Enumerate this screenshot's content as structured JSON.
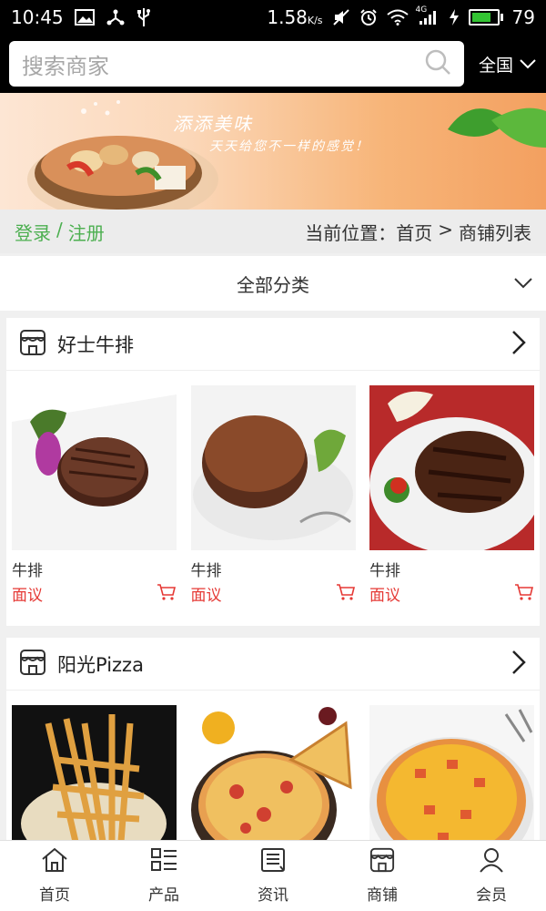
{
  "status": {
    "time": "10:45",
    "speed": "1.58",
    "speed_unit": "K/s",
    "network": "4G",
    "battery": "79",
    "battery_level": 0.79
  },
  "search": {
    "placeholder": "搜索商家"
  },
  "region": {
    "label": "全国"
  },
  "banner": {
    "line1": "添添美味",
    "line2": "天天给您不一样的感觉！"
  },
  "auth": {
    "login": "登录",
    "separator": "/",
    "register": "注册"
  },
  "breadcrumb": {
    "prefix": "当前位置：",
    "home": "首页",
    "separator": ">",
    "current": "商铺列表"
  },
  "category": {
    "label": "全部分类"
  },
  "shops": [
    {
      "name": "好士牛排",
      "products": [
        {
          "name": "牛排",
          "price": "面议"
        },
        {
          "name": "牛排",
          "price": "面议"
        },
        {
          "name": "牛排",
          "price": "面议"
        }
      ]
    },
    {
      "name": "阳光Pizza",
      "products": [
        {
          "name": "",
          "price": ""
        },
        {
          "name": "",
          "price": ""
        },
        {
          "name": "",
          "price": ""
        }
      ]
    }
  ],
  "nav": [
    {
      "label": "首页",
      "icon": "home-icon"
    },
    {
      "label": "产品",
      "icon": "grid-list-icon"
    },
    {
      "label": "资讯",
      "icon": "news-icon"
    },
    {
      "label": "商铺",
      "icon": "store-icon"
    },
    {
      "label": "会员",
      "icon": "user-icon"
    }
  ],
  "colors": {
    "accent": "#4caf50",
    "price": "#e53935",
    "header": "#000000"
  }
}
